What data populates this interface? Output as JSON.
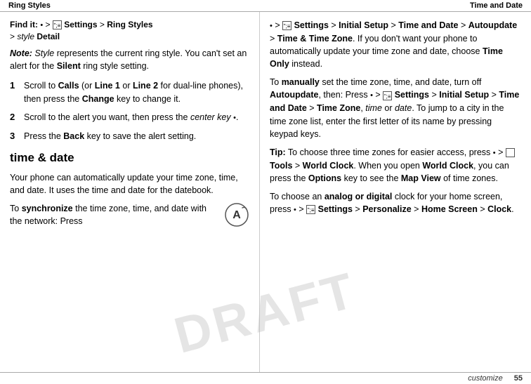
{
  "header": {
    "left_label": "Ring Styles",
    "right_label": "Time and Date"
  },
  "footer": {
    "page_number": "55",
    "section_label": "customize"
  },
  "left_column": {
    "find_it": {
      "prefix": "Find it:",
      "path": "· > Settings > Ring Styles > style Detail"
    },
    "note": {
      "label": "Note:",
      "text": " Style represents the current ring style. You can't set an alert for the Silent ring style setting."
    },
    "steps": [
      {
        "number": "1",
        "text": "Scroll to Calls (or Line 1 or Line 2 for dual-line phones), then press the Change key to change it."
      },
      {
        "number": "2",
        "text": "Scroll to the alert you want, then press the center key ·."
      },
      {
        "number": "3",
        "text": "Press the Back key to save the alert setting."
      }
    ],
    "section_heading": "time & date",
    "section_para": "Your phone can automatically update your time zone, time, and date. It uses the time and date for the datebook.",
    "sync_intro": "To synchronize the time zone, time, and date with the network: Press"
  },
  "right_column": {
    "sync_path": "· > Settings > Initial Setup > Time and Date > Autoupdate > Time & Time Zone.",
    "sync_tail": " If you don't want your phone to automatically update your time zone and date, choose Time Only instead.",
    "manual_para": {
      "intro": "To manually set the time zone, time, and date, turn off Autoupdate, then: Press",
      "path": "· > Settings > Initial Setup > Time and Date > Time Zone,",
      "tail": " time or date. To jump to a city in the time zone list, enter the first letter of its name by pressing keypad keys."
    },
    "tip": {
      "label": "Tip:",
      "text": " To choose three time zones for easier access, press · > Tools > World Clock. When you open World Clock, you can press the Options key to see the Map View of time zones."
    },
    "analog_para": {
      "intro": "To choose an analog or digital clock for your home screen, press",
      "path": "· > Settings > Personalize > Home Screen > Clock."
    }
  }
}
